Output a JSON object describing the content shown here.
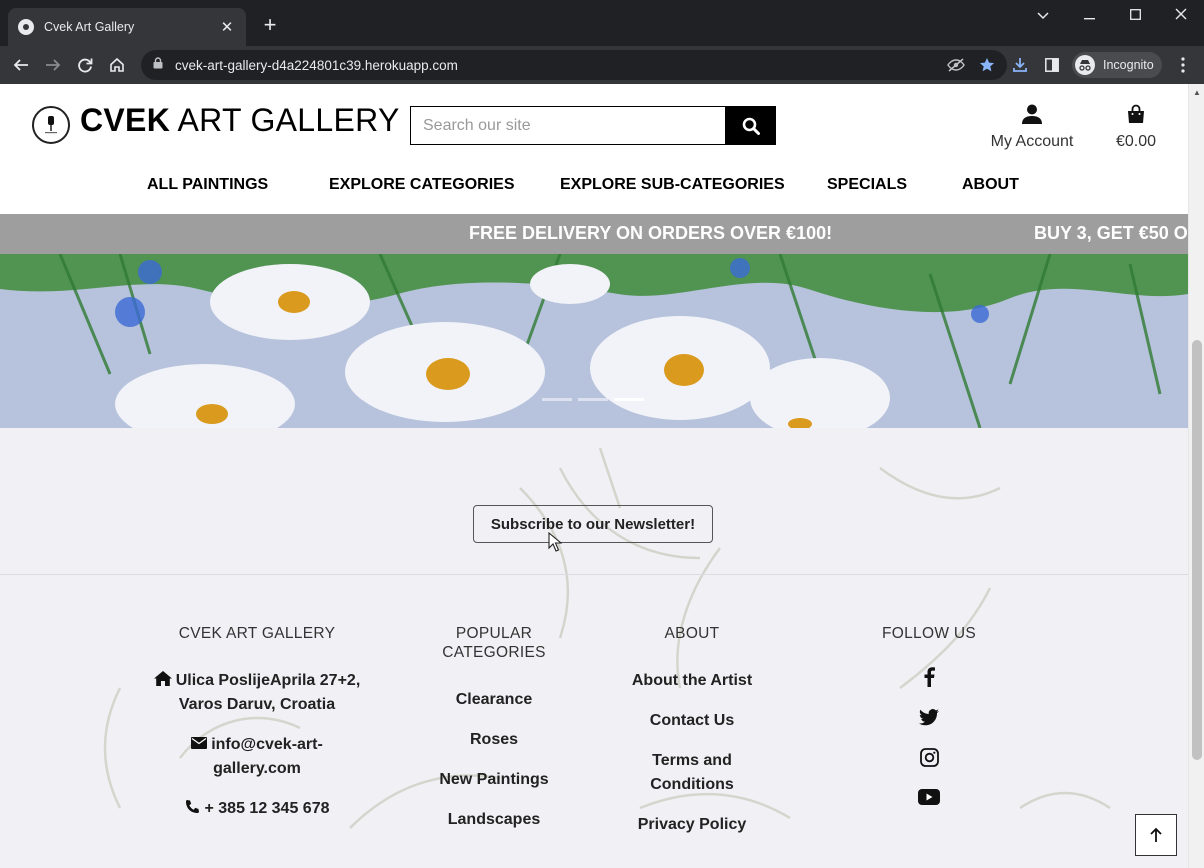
{
  "browser": {
    "tab_title": "Cvek Art Gallery",
    "url": "cvek-art-gallery-d4a224801c39.herokuapp.com",
    "profile_label": "Incognito"
  },
  "header": {
    "brand_bold": "CVEK",
    "brand_rest": " ART GALLERY",
    "search_placeholder": "Search our site",
    "account_label": "My Account",
    "cart_total": "€0.00"
  },
  "nav": {
    "items": [
      "ALL PAINTINGS",
      "EXPLORE CATEGORIES",
      "EXPLORE SUB-CATEGORIES",
      "SPECIALS",
      "ABOUT"
    ]
  },
  "banner": {
    "messages": [
      "FREE DELIVERY ON ORDERS OVER €100!",
      "BUY 3, GET €50 O"
    ]
  },
  "carousel": {
    "slide_count": 3,
    "active_slide": 3
  },
  "newsletter": {
    "button_label": "Subscribe to our Newsletter!"
  },
  "footer": {
    "gallery": {
      "heading": "CVEK ART GALLERY",
      "address_line1": "Ulica PoslijeAprila 27+2,",
      "address_line2": "Varos Daruv, Croatia",
      "email_line1": "info@cvek-art-",
      "email_line2": "gallery.com",
      "phone": "+ 385 12 345 678"
    },
    "categories": {
      "heading_line1": "POPULAR",
      "heading_line2": "CATEGORIES",
      "links": [
        "Clearance",
        "Roses",
        "New Paintings",
        "Landscapes"
      ]
    },
    "about": {
      "heading": "ABOUT",
      "link1": "About the Artist",
      "link2": "Contact Us",
      "link3_line1": "Terms and",
      "link3_line2": "Conditions",
      "link4": "Privacy Policy"
    },
    "follow": {
      "heading": "FOLLOW US",
      "icons": [
        "facebook-icon",
        "twitter-icon",
        "instagram-icon",
        "youtube-icon"
      ]
    }
  },
  "colors": {
    "banner_bg": "#9e9e9e",
    "chrome_dark": "#202124",
    "chrome_toolbar": "#35363a",
    "star_accent": "#8ab4f8"
  }
}
